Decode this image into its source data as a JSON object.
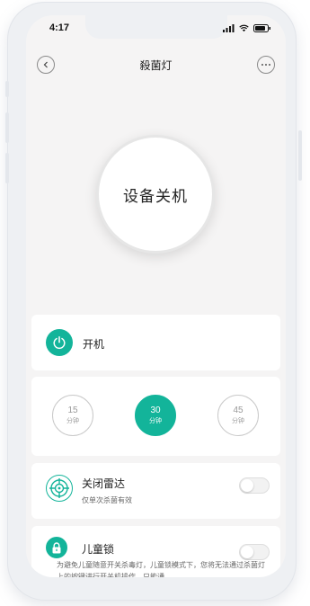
{
  "status_bar": {
    "time": "4:17"
  },
  "nav": {
    "title": "殺菌灯"
  },
  "device": {
    "state_label": "设备关机"
  },
  "power_card": {
    "label": "开机"
  },
  "timer": {
    "options": [
      {
        "value": "15",
        "unit": "分钟",
        "selected": false
      },
      {
        "value": "30",
        "unit": "分钟",
        "selected": true
      },
      {
        "value": "45",
        "unit": "分钟",
        "selected": false
      }
    ]
  },
  "radar_card": {
    "title": "关闭雷达",
    "subtitle": "仅单次杀菌有效",
    "enabled": false
  },
  "lock_card": {
    "title": "儿童锁",
    "description": "为避免儿童随意开关杀毒灯，儿童锁模式下，您将无法通过杀菌灯上的按键进行开关机操作，只能通",
    "enabled": false
  },
  "colors": {
    "accent": "#13b49a",
    "screen_bg": "#f5f4f4",
    "card_bg": "#ffffff"
  }
}
